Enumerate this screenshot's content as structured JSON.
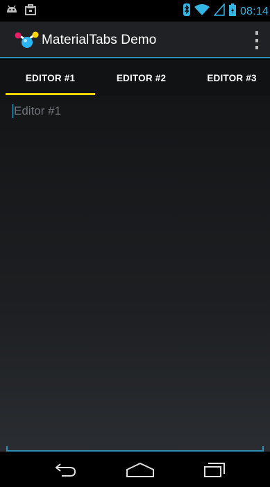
{
  "status_bar": {
    "time": "08:14",
    "left_icons": [
      "android-icon",
      "briefcase-icon"
    ],
    "right_icons": [
      "bluetooth-icon",
      "wifi-icon",
      "signal-icon",
      "battery-icon"
    ],
    "accent": "#33b5e5"
  },
  "action_bar": {
    "title": "MaterialTabs Demo",
    "icon": "app-logo-icon",
    "overflow_icon": "overflow-menu-icon"
  },
  "tabs": {
    "items": [
      {
        "label": "EDITOR #1",
        "selected": true
      },
      {
        "label": "EDITOR #2",
        "selected": false
      },
      {
        "label": "EDITOR #3",
        "selected": false
      }
    ],
    "indicator_color": "#ffd600"
  },
  "editor": {
    "placeholder": "Editor #1",
    "value": ""
  },
  "nav_bar": {
    "icons": [
      "back-icon",
      "home-icon",
      "recent-apps-icon"
    ]
  },
  "colors": {
    "divider": "#2c8fb3",
    "hint_text": "#70757c"
  }
}
